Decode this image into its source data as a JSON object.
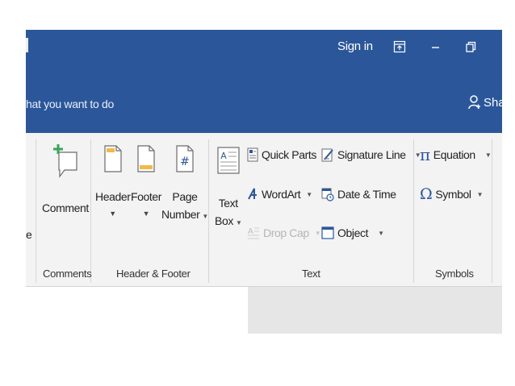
{
  "titlebar": {
    "sign_in": "Sign in",
    "icons": [
      "ribbon-display-options-icon",
      "minimize-icon",
      "restore-icon"
    ]
  },
  "tellme": {
    "text": "hat you want to do",
    "share_label": "Shar",
    "share_icon": "share-person-icon"
  },
  "ribbon": {
    "partial_left_label": "e",
    "comments": {
      "comment_label": "Comment",
      "group_label": "Comments"
    },
    "header_footer": {
      "header_label": "Header",
      "footer_label": "Footer",
      "page_label": "Page",
      "number_label": "Number",
      "group_label": "Header & Footer"
    },
    "text": {
      "text_label": "Text",
      "box_label": "Box",
      "quick_parts": "Quick Parts",
      "wordart": "WordArt",
      "drop_cap": "Drop Cap",
      "signature_line": "Signature Line",
      "date_time": "Date & Time",
      "object": "Object",
      "group_label": "Text"
    },
    "symbols": {
      "equation": "Equation",
      "symbol": "Symbol",
      "group_label": "Symbols"
    }
  },
  "colors": {
    "title_bar": "#2b579a",
    "ribbon_bg": "#f3f3f3",
    "accent_orange": "#f0b94a",
    "accent_blue": "#2b579a"
  }
}
